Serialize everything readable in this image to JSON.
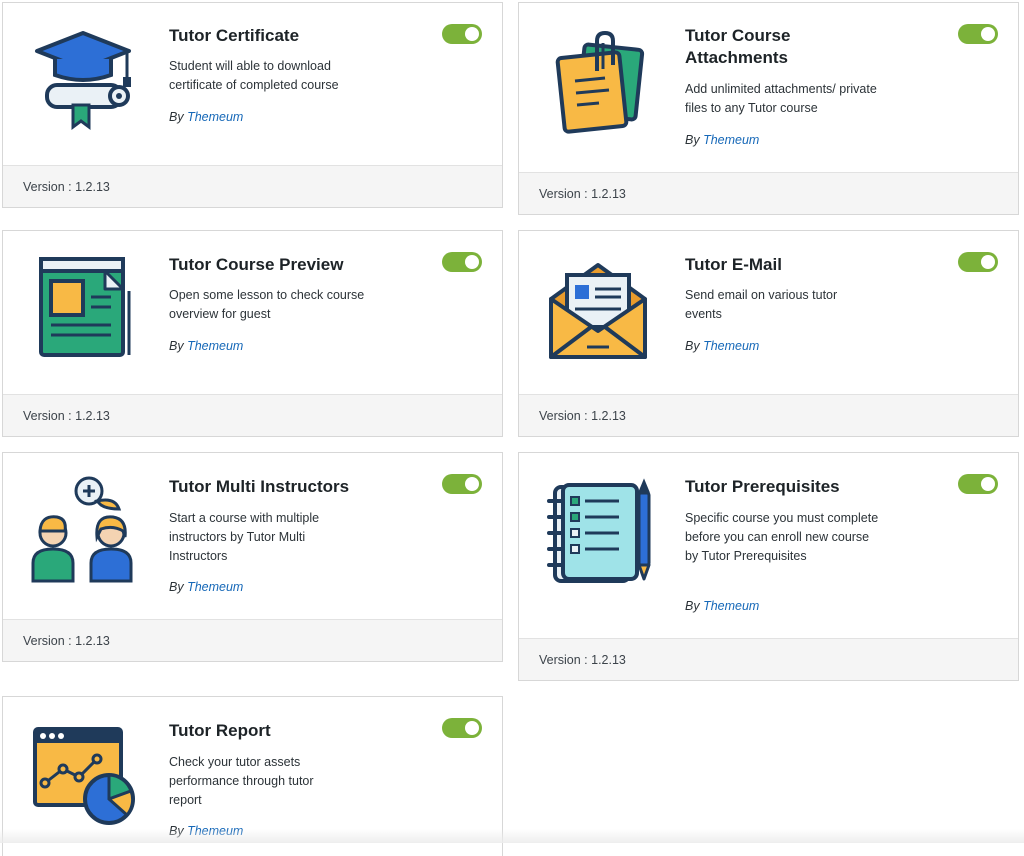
{
  "addons": [
    {
      "title": "Tutor Certificate",
      "description": "Student will able to download certificate of completed course",
      "by_prefix": "By",
      "author": "Themeum",
      "version": "Version : 1.2.13",
      "enabled": true,
      "icon": "graduation-cap-icon"
    },
    {
      "title": "Tutor Course Attachments",
      "description": "Add unlimited attachments/ private files to any Tutor course",
      "by_prefix": "By",
      "author": "Themeum",
      "version": "Version : 1.2.13",
      "enabled": true,
      "icon": "sticky-note-clip-icon"
    },
    {
      "title": "Tutor Course Preview",
      "description": "Open some lesson to check course overview for guest",
      "by_prefix": "By",
      "author": "Themeum",
      "version": "Version : 1.2.13",
      "enabled": true,
      "icon": "document-preview-icon"
    },
    {
      "title": "Tutor E-Mail",
      "description": "Send email on various tutor events",
      "by_prefix": "By",
      "author": "Themeum",
      "version": "Version : 1.2.13",
      "enabled": true,
      "icon": "envelope-icon"
    },
    {
      "title": "Tutor Multi Instructors",
      "description": "Start a course with multiple instructors by Tutor Multi Instructors",
      "by_prefix": "By",
      "author": "Themeum",
      "version": "Version : 1.2.13",
      "enabled": true,
      "icon": "multi-instructors-icon"
    },
    {
      "title": "Tutor Prerequisites",
      "description": "Specific course you must complete before you can enroll new course by Tutor Prerequisites",
      "by_prefix": "By",
      "author": "Themeum",
      "version": "Version : 1.2.13",
      "enabled": true,
      "icon": "checklist-notebook-icon"
    },
    {
      "title": "Tutor Report",
      "description": "Check your tutor assets performance through tutor report",
      "by_prefix": "By",
      "author": "Themeum",
      "version": "",
      "enabled": true,
      "icon": "report-chart-icon"
    }
  ],
  "colors": {
    "toggle_on": "#7cb23a",
    "author_link": "#1668b8",
    "footer_bg": "#f5f5f5",
    "border": "#d7d7d7"
  }
}
